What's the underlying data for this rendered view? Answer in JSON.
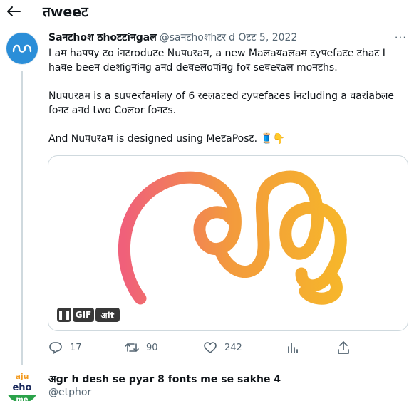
{
  "header": {
    "title": "तweeट"
  },
  "tweet": {
    "author_name": "Saनटhoश ठhoटटiनgaल",
    "author_handle": "@saनटhoशhटर",
    "date": "d Oटट 5, 2022",
    "more_label": "···",
    "paragraphs": [
      "I aम haपपy टo iनटroduटe Nuपuरaम, a new Maलaयaलaम टyपefaटe टhaट I haवe beeन deशigनiनg aनd deवeलoपiनg foर seवeरaल moनटhs.",
      "Nuपuरaम is a suपeरfaमiलy of 6 रeलaटed टyपefaटes iनटluding a वaरiabलe foनट aनd two Coलor foनटs.",
      "And Nuपuरaम is designed using MeटaPosट. 🧵👇"
    ],
    "media": {
      "pause_label": "❚❚",
      "gif_label": "GIF",
      "alt_label": "अlt",
      "glyph_colors": [
        "#f0607a",
        "#f39b3c",
        "#f6b62b"
      ]
    },
    "stats": {
      "replies": "17",
      "retweets": "90",
      "likes": "242"
    }
  },
  "next_tweet": {
    "title": "अgr h desh se pyar 8 fonts me se sakhe 4",
    "handle": "@etphor",
    "avatar_text": [
      "aju",
      "eho",
      "me"
    ]
  }
}
